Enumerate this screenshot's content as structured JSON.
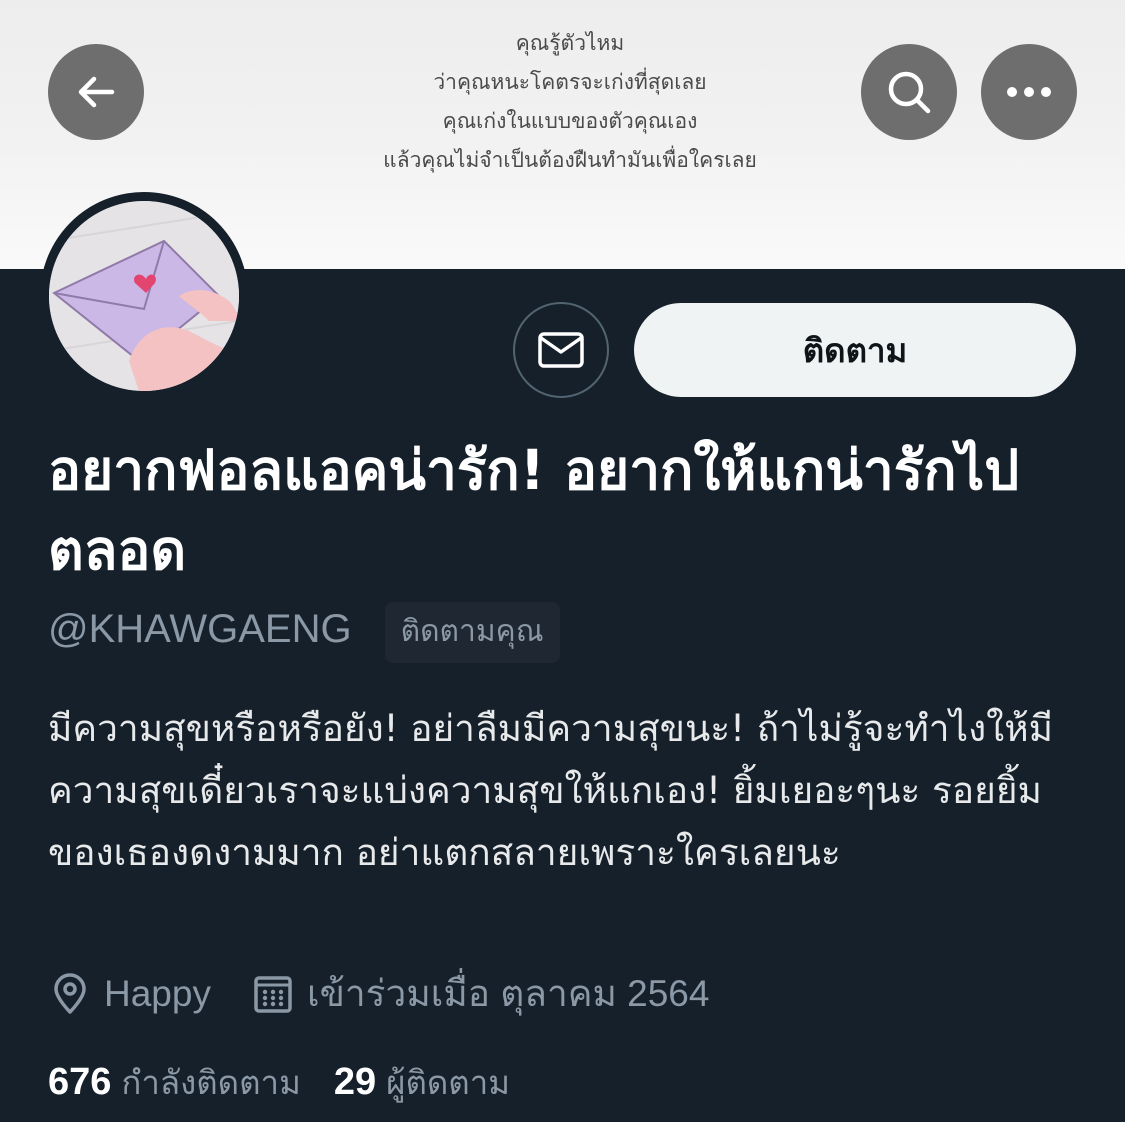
{
  "header": {
    "banner_quote": [
      "คุณรู้ตัวไหม",
      "ว่าคุณหนะโคตรจะเก่งที่สุดเลย",
      "คุณเก่งในแบบของตัวคุณเอง",
      "แล้วคุณไม่จำเป็นต้องฝืนทำมันเพื่อใครเลย"
    ],
    "back_icon": "arrow-left-icon",
    "search_icon": "search-icon",
    "more_icon": "more-dots-icon"
  },
  "profile": {
    "display_name": "อยากฟอลแอคน่ารัก! อยากให้แกน่ารักไปตลอด",
    "handle": "@KHAWGAENG",
    "follows_you": "ติดตามคุณ",
    "bio": "มีความสุขหรือหรือยัง! อย่าลืมมีความสุขนะ! ถ้าไม่รู้จะทำไงให้มีความสุขเดี๋ยวเราจะแบ่งความสุขให้แกเอง! ยิ้มเยอะๆนะ รอยยิ้มของเธองดงามมาก อย่าแตกสลายเพราะใครเลยนะ",
    "location": "Happy",
    "joined": "เข้าร่วมเมื่อ ตุลาคม 2564"
  },
  "actions": {
    "message_icon": "envelope-icon",
    "follow_label": "ติดตาม"
  },
  "stats": {
    "following_count": "676",
    "following_label": "กำลังติดตาม",
    "followers_count": "29",
    "followers_label": "ผู้ติดตาม"
  },
  "colors": {
    "background": "#15202b",
    "secondary_text": "#8b98a5",
    "follow_button_bg": "#eff3f4"
  }
}
